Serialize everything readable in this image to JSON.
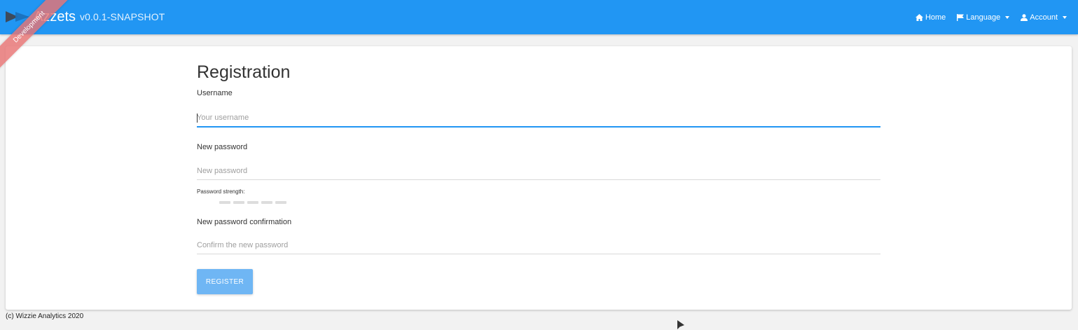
{
  "app": {
    "name": "Azzets",
    "version": "v0.0.1-SNAPSHOT",
    "ribbon": "Development"
  },
  "nav": {
    "home": {
      "label": "Home",
      "icon": "home-icon"
    },
    "language": {
      "label": "Language",
      "icon": "flag-icon"
    },
    "account": {
      "label": "Account",
      "icon": "user-icon"
    }
  },
  "form": {
    "title": "Registration",
    "username": {
      "label": "Username",
      "placeholder": "Your username",
      "value": ""
    },
    "password": {
      "label": "New password",
      "placeholder": "New password",
      "value": ""
    },
    "strength": {
      "label": "Password strength:",
      "level": 0,
      "segments": 5
    },
    "confirm": {
      "label": "New password confirmation",
      "placeholder": "Confirm the new password",
      "value": ""
    },
    "submit": "REGISTER"
  },
  "footer": {
    "text": "(c) Wizzie Analytics 2020"
  },
  "colors": {
    "primary": "#2196f3",
    "button": "#6fb6f4",
    "ribbon": "#e87474"
  }
}
